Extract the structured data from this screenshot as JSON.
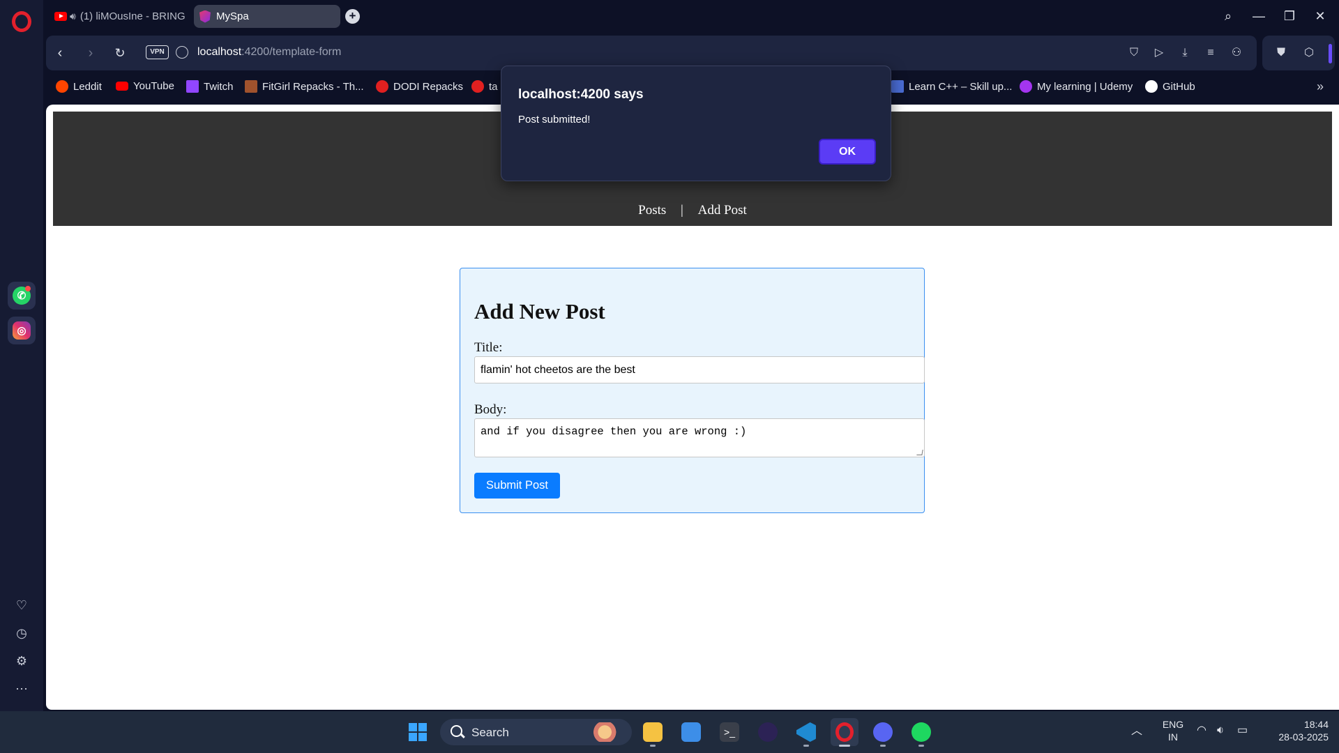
{
  "browser": {
    "tabs": [
      {
        "label": "(1) liMOusIne - BRING",
        "type": "youtube"
      },
      {
        "label": "MySpa",
        "type": "angular"
      }
    ],
    "url_host": "localhost",
    "url_rest": ":4200/template-form",
    "vpn_label": "VPN",
    "accent_color": "#6a4dff"
  },
  "bookmarks": [
    {
      "label": "Leddit",
      "icon": "reddit-icon",
      "color": "#ff4500"
    },
    {
      "label": "YouTube",
      "icon": "youtube-icon",
      "color": "#ff0000"
    },
    {
      "label": "Twitch",
      "icon": "twitch-icon",
      "color": "#9146ff"
    },
    {
      "label": "FitGirl Repacks - Th...",
      "icon": "fitgirl-icon",
      "color": "#a0522d"
    },
    {
      "label": "DODI Repacks",
      "icon": "dodi-icon",
      "color": "#e02020"
    },
    {
      "label": "ta",
      "icon": "tuf-icon",
      "color": "#e02020"
    },
    {
      "label": "Learn C++ – Skill up...",
      "icon": "learncpp-icon",
      "color": "#4a6cd4"
    },
    {
      "label": "My learning | Udemy",
      "icon": "udemy-icon",
      "color": "#a435f0"
    },
    {
      "label": "GitHub",
      "icon": "github-icon",
      "color": "#ffffff"
    }
  ],
  "app": {
    "nav": {
      "posts": "Posts",
      "separator": "|",
      "add_post": "Add Post"
    },
    "form": {
      "heading": "Add New Post",
      "title_label": "Title:",
      "title_value": "flamin' hot cheetos are the best",
      "body_label": "Body:",
      "body_value": "and if you disagree then you are wrong :)",
      "submit_label": "Submit Post"
    },
    "header_bg": "#333333",
    "button_color": "#0a7cff"
  },
  "dialog": {
    "title": "localhost:4200 says",
    "message": "Post submitted!",
    "ok_label": "OK",
    "ok_color": "#5b3cf5"
  },
  "taskbar": {
    "search_label": "Search",
    "lang_line1": "ENG",
    "lang_line2": "IN",
    "time": "18:44",
    "date": "28-03-2025"
  }
}
